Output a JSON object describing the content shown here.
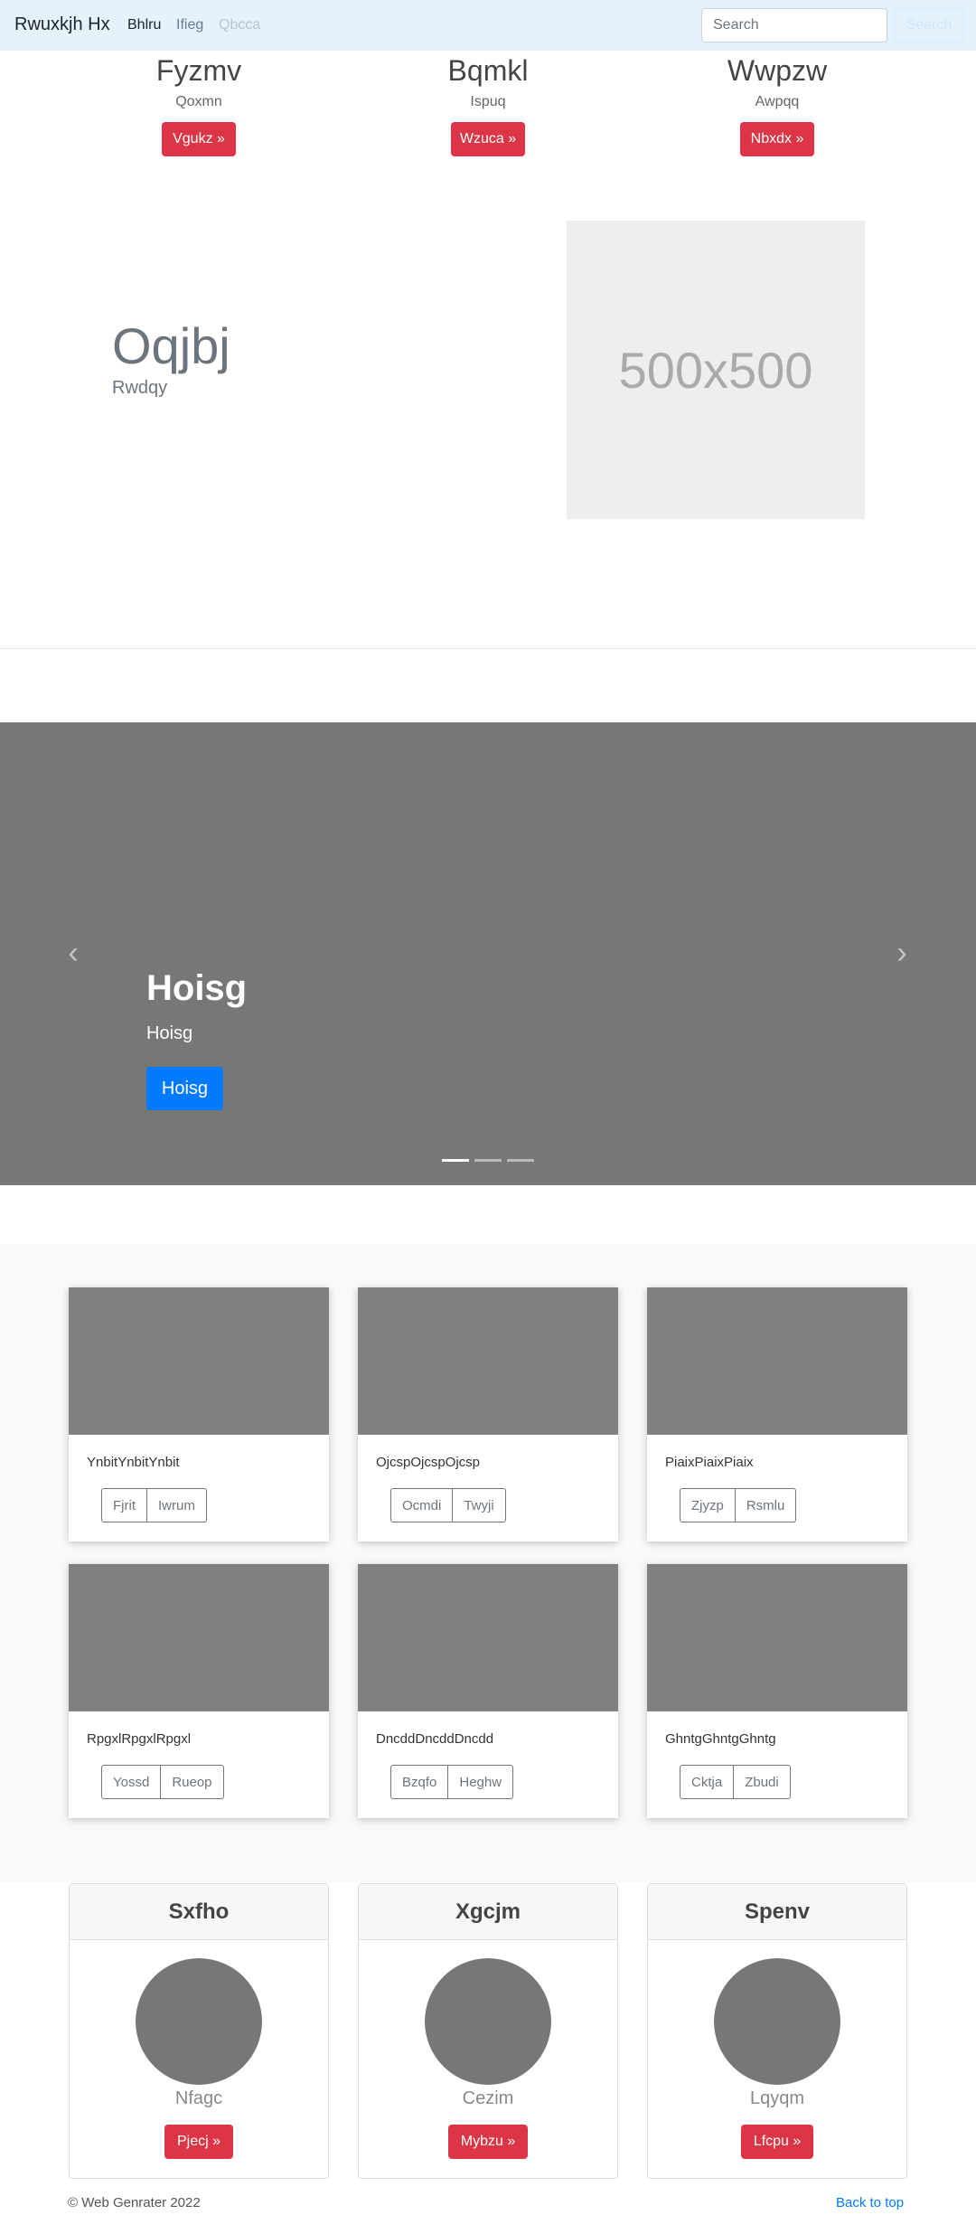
{
  "navbar": {
    "brand": "Rwuxkjh Hx",
    "links": [
      "Bhlru",
      "Ifieg",
      "Qbcca"
    ],
    "search_placeholder": "Search",
    "search_button": "Search"
  },
  "features": [
    {
      "title": "Fyzmv",
      "text": "Qoxmn",
      "button": "Vgukz »"
    },
    {
      "title": "Bqmkl",
      "text": "Ispuq",
      "button": "Wzuca »"
    },
    {
      "title": "Wwpzw",
      "text": "Awpqq",
      "button": "Nbxdx »"
    }
  ],
  "hero": {
    "title": "Oqjbj",
    "subtitle": "Rwdqy",
    "image_label": "500x500"
  },
  "carousel": {
    "title": "Hoisg",
    "text": "Hoisg",
    "button": "Hoisg",
    "prev_glyph": "‹",
    "next_glyph": "›",
    "indicator_count": 3,
    "active_indicator": 0
  },
  "album": [
    {
      "text": "YnbitYnbitYnbit",
      "buttons": [
        "Fjrit",
        "Iwrum"
      ]
    },
    {
      "text": "OjcspOjcspOjcsp",
      "buttons": [
        "Ocmdi",
        "Twyji"
      ]
    },
    {
      "text": "PiaixPiaixPiaix",
      "buttons": [
        "Zjyzp",
        "Rsmlu"
      ]
    },
    {
      "text": "RpgxlRpgxlRpgxl",
      "buttons": [
        "Yossd",
        "Rueop"
      ]
    },
    {
      "text": "DncddDncddDncdd",
      "buttons": [
        "Bzqfo",
        "Heghw"
      ]
    },
    {
      "text": "GhntgGhntgGhntg",
      "buttons": [
        "Cktja",
        "Zbudi"
      ]
    }
  ],
  "profiles": [
    {
      "header": "Sxfho",
      "name": "Nfagc",
      "button": "Pjecj »"
    },
    {
      "header": "Xgcjm",
      "name": "Cezim",
      "button": "Mybzu »"
    },
    {
      "header": "Spenv",
      "name": "Lqyqm",
      "button": "Lfcpu »"
    }
  ],
  "footer": {
    "copyright": "© Web Genrater 2022",
    "back_to_top": "Back to top"
  }
}
